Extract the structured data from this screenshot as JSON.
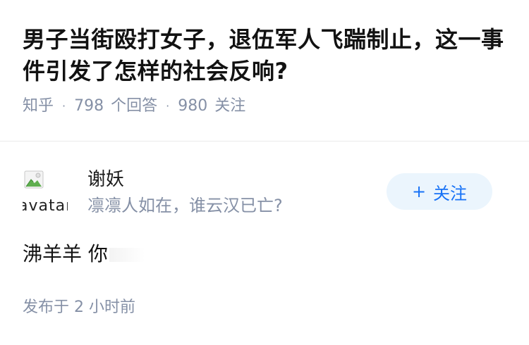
{
  "question": {
    "title": "男子当街殴打女子，退伍军人飞踹制止，这一事件引发了怎样的社会反响?",
    "source": "知乎",
    "answer_count": "798",
    "answer_label": "个回答",
    "follower_count": "980",
    "follower_label": "关注"
  },
  "author": {
    "avatar_alt": "avatar",
    "name": "谢妖",
    "bio": "凛凛人如在，谁云汉已亡?",
    "follow_button_label": "关注",
    "follow_icon": "plus-icon"
  },
  "answer": {
    "text": "沸羊羊 你"
  },
  "meta": {
    "publish_label": "发布于",
    "publish_time": "2 小时前"
  },
  "colors": {
    "accent": "#1772f6",
    "button_bg": "#ebf5fd",
    "muted_text": "#8590a6",
    "divider": "#ebebeb"
  }
}
